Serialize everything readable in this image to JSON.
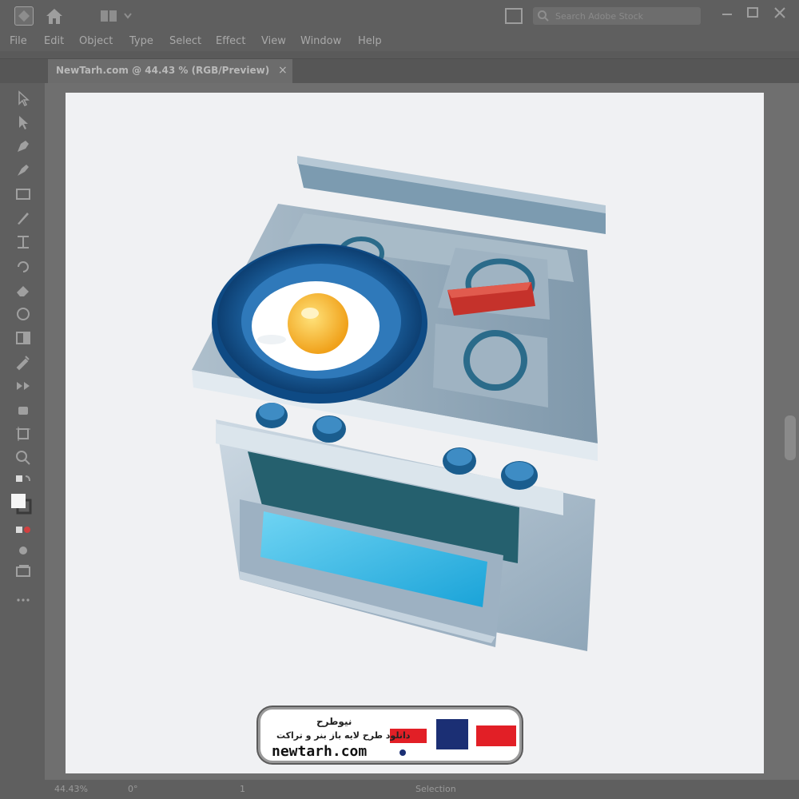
{
  "window": {
    "search_placeholder": "Search Adobe Stock"
  },
  "menu": [
    "File",
    "Edit",
    "Object",
    "Type",
    "Select",
    "Effect",
    "View",
    "Window",
    "Help"
  ],
  "document_tab": {
    "title": "NewTarh.com @ 44.43 % (RGB/Preview)",
    "close": "×"
  },
  "status": {
    "zoom": "44.43%",
    "rotation": "0°",
    "artboard": "1",
    "mode": "Selection"
  },
  "watermark": {
    "brand": "نیوطرح",
    "tagline": "دانلود طرح لایه باز بنر و تراکت",
    "url": "newtarh.com",
    "logo_text": "نیوطرح"
  },
  "colors": {
    "chrome": "#5f5f5f",
    "artboard": "#f0f1f3",
    "pan_blue": "#1f6fb0",
    "knob_red": "#c5322b",
    "oven_window": "#2fb7e3"
  }
}
